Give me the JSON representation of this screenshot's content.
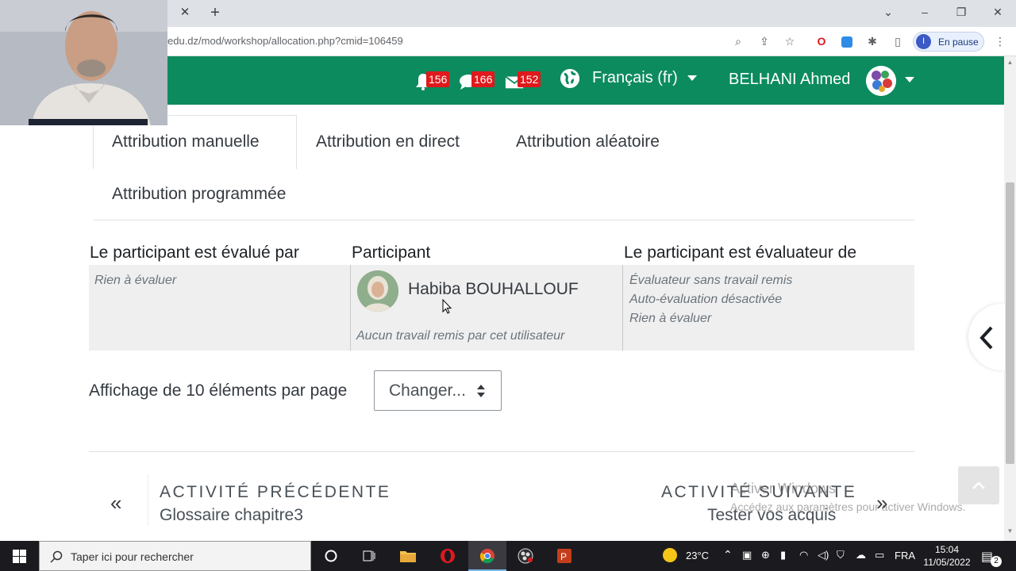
{
  "browser": {
    "url": "edu.dz/mod/workshop/allocation.php?cmid=106459",
    "profile_status": "En pause",
    "profile_initial": "I"
  },
  "navbar": {
    "notifications_count": "156",
    "messages_count": "166",
    "mail_count": "152",
    "language": "Français (fr)",
    "user_name": "BELHANI Ahmed"
  },
  "tabs": [
    {
      "label": "Attribution manuelle",
      "active": true
    },
    {
      "label": "Attribution en direct",
      "active": false
    },
    {
      "label": "Attribution aléatoire",
      "active": false
    },
    {
      "label": "Attribution programmée",
      "active": false
    }
  ],
  "table": {
    "headers": [
      "Le participant est évalué par",
      "Participant",
      "Le participant est évaluateur de"
    ],
    "row": {
      "evaluated_by": "Rien à évaluer",
      "participant_name": "Habiba BOUHALLOUF",
      "participant_note": "Aucun travail remis par cet utilisateur",
      "evaluator_of": [
        "Évaluateur sans travail remis",
        "Auto-évaluation désactivée",
        "Rien à évaluer"
      ]
    }
  },
  "perpage": {
    "label": "Affichage de 10 éléments par page",
    "select_value": "Changer..."
  },
  "activity_nav": {
    "previous_heading": "ACTIVITÉ PRÉCÉDENTE",
    "previous_title": "Glossaire chapitre3",
    "next_heading": "ACTIVITÉ SUIVANTE",
    "next_title": "Tester vos acquis"
  },
  "watermark": {
    "line1": "Activer Windows",
    "line2": "Accédez aux paramètres pour activer Windows."
  },
  "taskbar": {
    "search_placeholder": "Taper ici pour rechercher",
    "temperature": "23°C",
    "language": "FRA",
    "time": "15:04",
    "date": "11/05/2022",
    "notification_count": "2"
  },
  "colors": {
    "navbar_green": "#0c8b5f",
    "badge_red": "#e0191c"
  }
}
